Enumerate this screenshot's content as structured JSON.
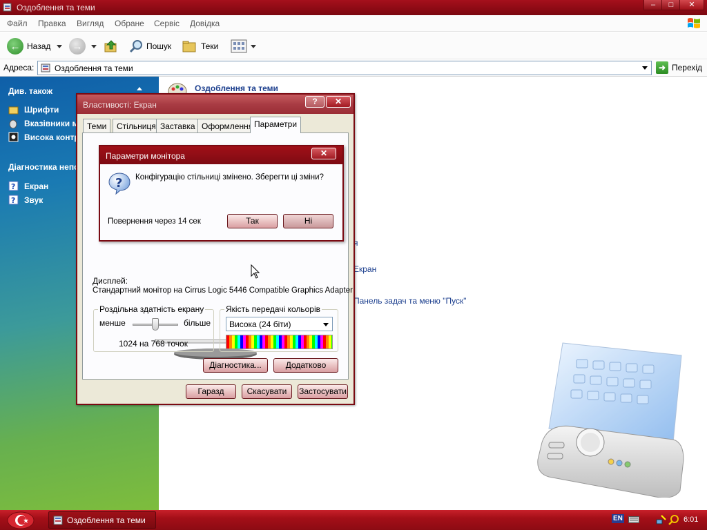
{
  "window": {
    "title": "Оздоблення та теми",
    "buttons": [
      "–",
      "□",
      "✕"
    ]
  },
  "menu": [
    "Файл",
    "Правка",
    "Вигляд",
    "Обране",
    "Сервіс",
    "Довідка"
  ],
  "toolbar": {
    "back": "Назад",
    "search": "Пошук",
    "folders": "Теки"
  },
  "address": {
    "label": "Адреса:",
    "value": "Оздоблення та теми",
    "go": "Перехід"
  },
  "sidebar": {
    "see_also_title": "Див. також",
    "see_also": [
      "Шрифти",
      "Вказівники ми",
      "Висока контр"
    ],
    "troubleshoot_title": "Діагностика непо",
    "troubleshoot": [
      "Екран",
      "Звук"
    ]
  },
  "content": {
    "header": "Оздоблення та теми",
    "links": [
      "я",
      "Екран",
      "Панель задач та меню \"Пуск\""
    ]
  },
  "display_props": {
    "title": "Властивості: Екран",
    "help_btn": "?",
    "close_btn": "✕",
    "tabs": [
      "Теми",
      "Стільниця",
      "Заставка",
      "Оформлення",
      "Параметри"
    ],
    "active_tab": "Параметри",
    "display_label": "Дисплей:",
    "display_value": "Стандартний монітор на Cirrus Logic 5446 Compatible Graphics Adapter",
    "resolution": {
      "group_label": "Роздільна здатність екрану",
      "less": "менше",
      "more": "більше",
      "value": "1024 на 768 точок"
    },
    "color": {
      "group_label": "Якість передачі кольорів",
      "selected": "Висока (24 біти)"
    },
    "diagnostics_btn": "Діагностика...",
    "advanced_btn": "Додатково",
    "ok_btn": "Гаразд",
    "cancel_btn": "Скасувати",
    "apply_btn": "Застосувати"
  },
  "monitor_dialog": {
    "title": "Параметри монітора",
    "close_btn": "✕",
    "message": "Конфігурацію стільниці змінено. Зберегти ці зміни?",
    "countdown": "Повернення через 14 сек",
    "yes_btn": "Так",
    "no_btn": "Ні"
  },
  "taskbar": {
    "task_label": "Оздоблення та теми",
    "lang": "EN",
    "clock": "6:01"
  },
  "colors": {
    "title_red": "#8c0a14",
    "taskbar_red": "#a40f18",
    "link_blue": "#1c3f8e"
  }
}
